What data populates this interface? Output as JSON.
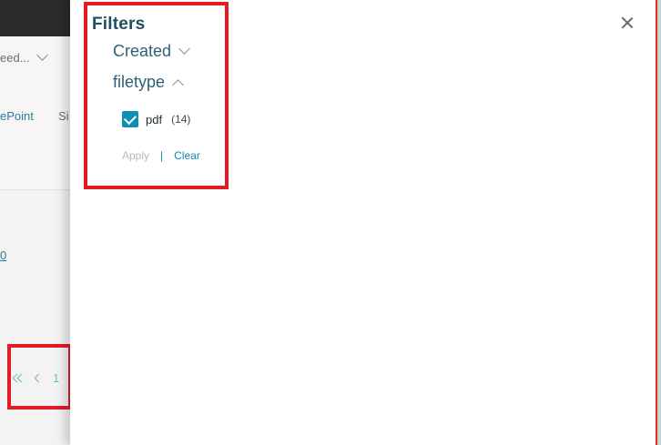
{
  "background": {
    "feed_text": "eed...",
    "tab_1": "ePoint",
    "tab_2": "Si",
    "link_text": "0",
    "pager": {
      "page_number": "1"
    }
  },
  "filters_panel": {
    "title": "Filters",
    "facets": [
      {
        "label": "Created",
        "state": "collapsed"
      },
      {
        "label": "filetype",
        "state": "expanded"
      }
    ],
    "filetype_options": [
      {
        "label": "pdf",
        "count": "(14)",
        "checked": true
      }
    ],
    "actions": {
      "apply": "Apply",
      "separator": "|",
      "clear": "Clear"
    }
  },
  "colors": {
    "highlight": "#e31b23",
    "accent": "#0f8fb3",
    "title": "#1d4f63",
    "facet": "#2f6077",
    "link": "#1b86ad"
  },
  "icons": {
    "close": "close-icon",
    "chevron_down": "chevron-down-icon",
    "chevron_up": "chevron-up-icon",
    "check": "check-icon",
    "first_page": "first-page-icon",
    "prev_page": "previous-page-icon"
  }
}
